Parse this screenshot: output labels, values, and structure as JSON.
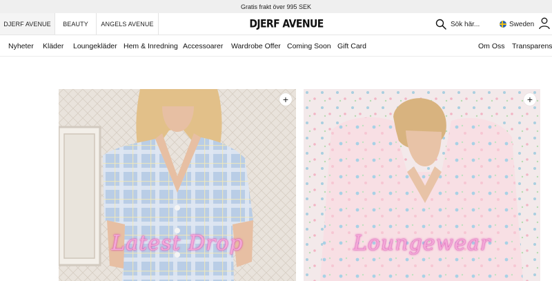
{
  "promo": {
    "text": "Gratis frakt över 995 SEK"
  },
  "brand_tabs": [
    {
      "label": "DJERF AVENUE",
      "active": true
    },
    {
      "label": "BEAUTY",
      "active": false
    },
    {
      "label": "ANGELS AVENUE",
      "active": false
    }
  ],
  "logo": {
    "text": "DJERF AVENUE"
  },
  "search": {
    "placeholder": "Sök här...",
    "icon": "search-icon"
  },
  "country": {
    "label": "Sweden",
    "icon": "sweden-flag-icon"
  },
  "account": {
    "icon": "user-icon"
  },
  "nav": {
    "items": [
      "Nyheter",
      "Kläder",
      "Loungekläder",
      "Hem & Inredning",
      "Accessoarer",
      "Wardrobe Offer",
      "Coming Soon",
      "Gift Card"
    ],
    "right_items": [
      "Om Oss",
      "Transparens"
    ]
  },
  "cards": [
    {
      "title": "Latest Drop",
      "icon": "plus-icon",
      "title_color": "#f4a8d8"
    },
    {
      "title": "Loungewear",
      "icon": "plus-icon",
      "title_color": "#f4a8d8"
    }
  ]
}
